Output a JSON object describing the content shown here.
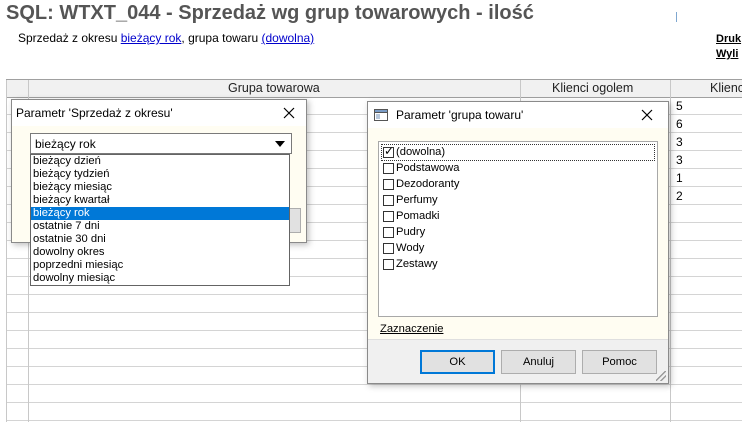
{
  "report": {
    "title": "SQL: WTXT_044 - Sprzedaż wg grup towarowych - ilość",
    "subtitle_prefix": "Sprzedaż z okresu ",
    "period_link": "bieżący rok",
    "subtitle_middle": ", grupa towaru ",
    "group_link": "(dowolna)",
    "right_link_1": "Druk",
    "right_link_2": "Wyli"
  },
  "table": {
    "columns": [
      "Grupa towarowa",
      "Klienci ogolem",
      "Klienc"
    ],
    "visible_values": [
      "5",
      "6",
      "3",
      "3",
      "1",
      "2"
    ]
  },
  "dialog_period": {
    "title": "Parametr 'Sprzedaż z okresu'",
    "selected": "bieżący rok",
    "options": [
      "bieżący dzień",
      "bieżący tydzień",
      "bieżący miesiąc",
      "bieżący kwartał",
      "bieżący rok",
      "ostatnie 7 dni",
      "ostatnie 30 dni",
      "dowolny okres",
      "poprzedni miesiąc",
      "dowolny miesiąc"
    ],
    "highlighted_index": 4
  },
  "dialog_group": {
    "title": "Parametr 'grupa towaru'",
    "items": [
      {
        "label": "(dowolna)",
        "checked": true
      },
      {
        "label": "Podstawowa",
        "checked": false
      },
      {
        "label": "Dezodoranty",
        "checked": false
      },
      {
        "label": "Perfumy",
        "checked": false
      },
      {
        "label": "Pomadki",
        "checked": false
      },
      {
        "label": "Pudry",
        "checked": false
      },
      {
        "label": "Wody",
        "checked": false
      },
      {
        "label": "Zestawy",
        "checked": false
      }
    ],
    "selection_link": "Zaznaczenie",
    "ok_label": "OK",
    "cancel_label": "Anuluj",
    "help_label": "Pomoc"
  },
  "colors": {
    "link": "#0000cc",
    "selection": "#0078d7",
    "dialog_body": "#fffdf2",
    "title_gray": "#555555"
  }
}
